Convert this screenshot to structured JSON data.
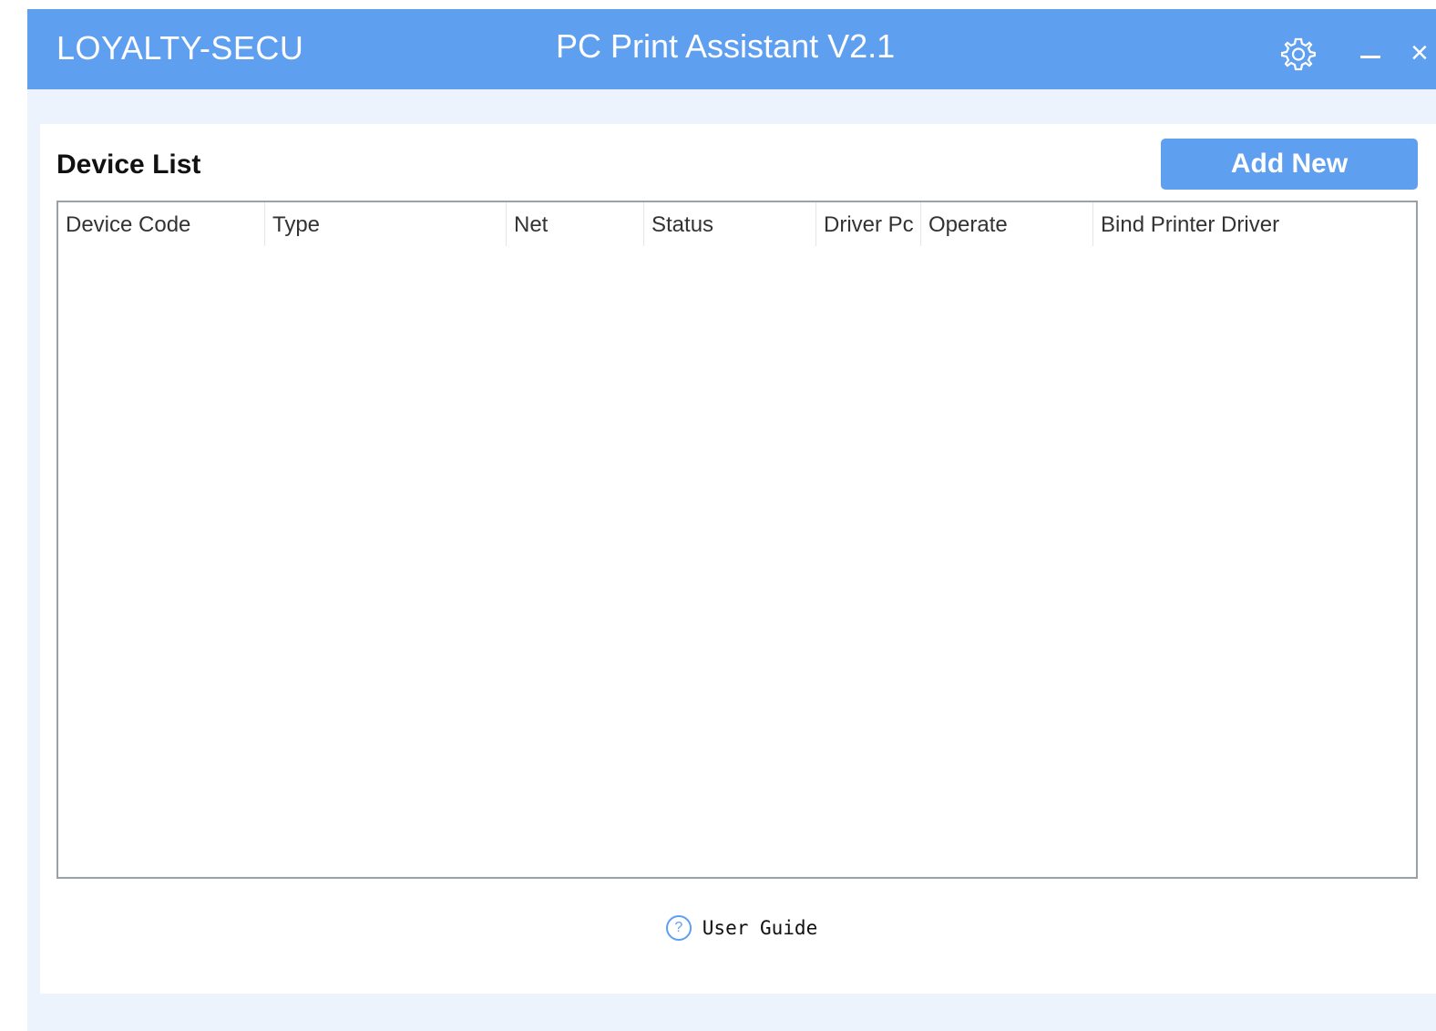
{
  "titlebar": {
    "brand": "LOYALTY-SECU",
    "title": "PC Print Assistant V2.1",
    "icons": [
      "gear-icon",
      "minimize-icon",
      "close-icon"
    ],
    "close_glyph": "×"
  },
  "device_list": {
    "title": "Device List",
    "add_button": "Add New",
    "columns": [
      "Device Code",
      "Type",
      "Net",
      "Status",
      "Driver Pc",
      "Operate",
      "Bind Printer Driver"
    ],
    "rows": []
  },
  "footer": {
    "help_glyph": "?",
    "guide_label": "User Guide"
  },
  "colors": {
    "accent": "#5f9ff0",
    "background": "#edf3fc"
  }
}
